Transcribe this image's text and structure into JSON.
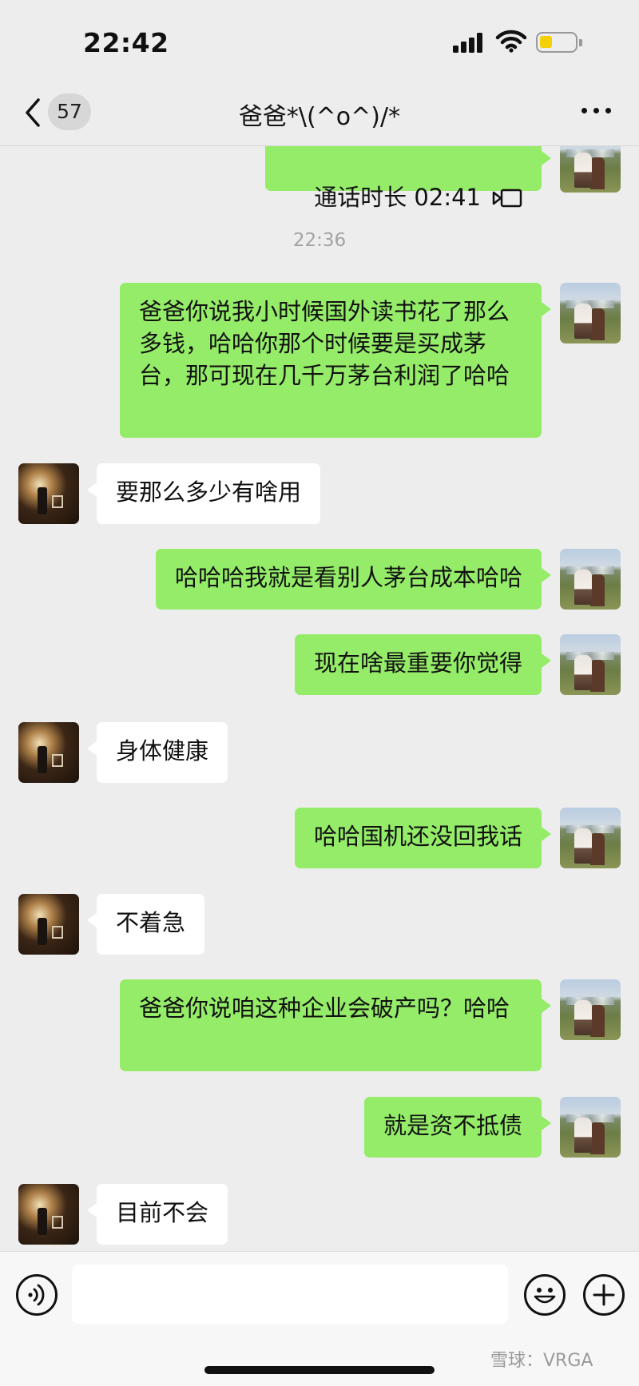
{
  "status_bar": {
    "time": "22:42"
  },
  "nav": {
    "back_count": "57",
    "title": "爸爸*\\(^o^)/*"
  },
  "chat": {
    "call_record": "通话时长 02:41",
    "timestamp": "22:36",
    "messages": [
      {
        "from": "me",
        "text": "爸爸你说我小时候国外读书花了那么多钱，哈哈你那个时候要是买成茅台，那可现在几千万茅台利润了哈哈"
      },
      {
        "from": "dad",
        "text": "要那么多少有啥用"
      },
      {
        "from": "me",
        "text": "哈哈哈我就是看别人茅台成本哈哈"
      },
      {
        "from": "me",
        "text": "现在啥最重要你觉得"
      },
      {
        "from": "dad",
        "text": "身体健康"
      },
      {
        "from": "me",
        "text": "哈哈国机还没回我话"
      },
      {
        "from": "dad",
        "text": "不着急"
      },
      {
        "from": "me",
        "text": "爸爸你说咱这种企业会破产吗？哈哈"
      },
      {
        "from": "me",
        "text": "就是资不抵债"
      },
      {
        "from": "dad",
        "text": "目前不会"
      }
    ]
  },
  "input_bar": {
    "watermark": "雪球：VRGA"
  },
  "icons": [
    "back-chevron-icon",
    "more-icon",
    "video-call-icon",
    "voice-icon",
    "emoji-icon",
    "plus-icon"
  ],
  "colors": {
    "my_bubble": "#95ec69",
    "dad_bubble": "#ffffff",
    "background": "#ededed"
  }
}
